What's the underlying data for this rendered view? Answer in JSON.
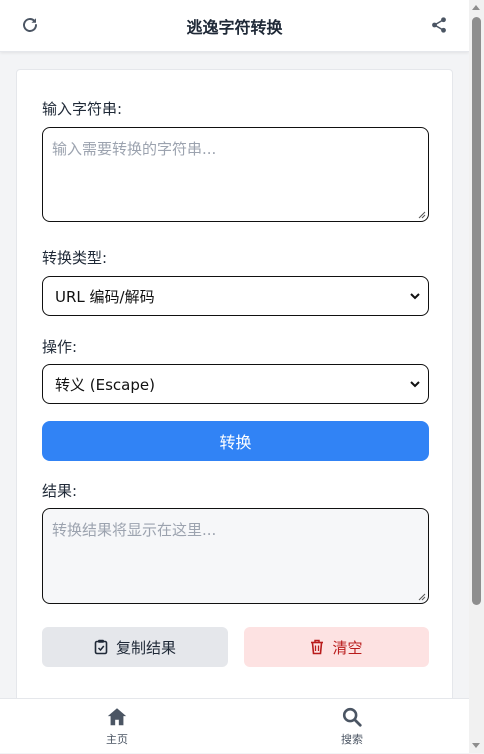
{
  "header": {
    "title": "逃逸字符转换",
    "left_icon": "refresh-icon",
    "right_icon": "share-icon"
  },
  "input": {
    "label": "输入字符串:",
    "placeholder": "输入需要转换的字符串...",
    "value": ""
  },
  "conversion_type": {
    "label": "转换类型:",
    "selected": "URL 编码/解码"
  },
  "operation": {
    "label": "操作:",
    "selected": "转义 (Escape)"
  },
  "convert_button": {
    "label": "转换"
  },
  "result": {
    "label": "结果:",
    "placeholder": "转换结果将显示在这里..."
  },
  "actions": {
    "copy_label": "复制结果",
    "clear_label": "清空"
  },
  "bottom_nav": {
    "items": [
      {
        "label": "主页",
        "icon": "home-icon"
      },
      {
        "label": "搜索",
        "icon": "search-icon"
      }
    ]
  },
  "colors": {
    "primary": "#3183f5",
    "danger_bg": "#fde2e2",
    "danger_text": "#b91c1c",
    "neutral_bg": "#e5e7eb"
  }
}
